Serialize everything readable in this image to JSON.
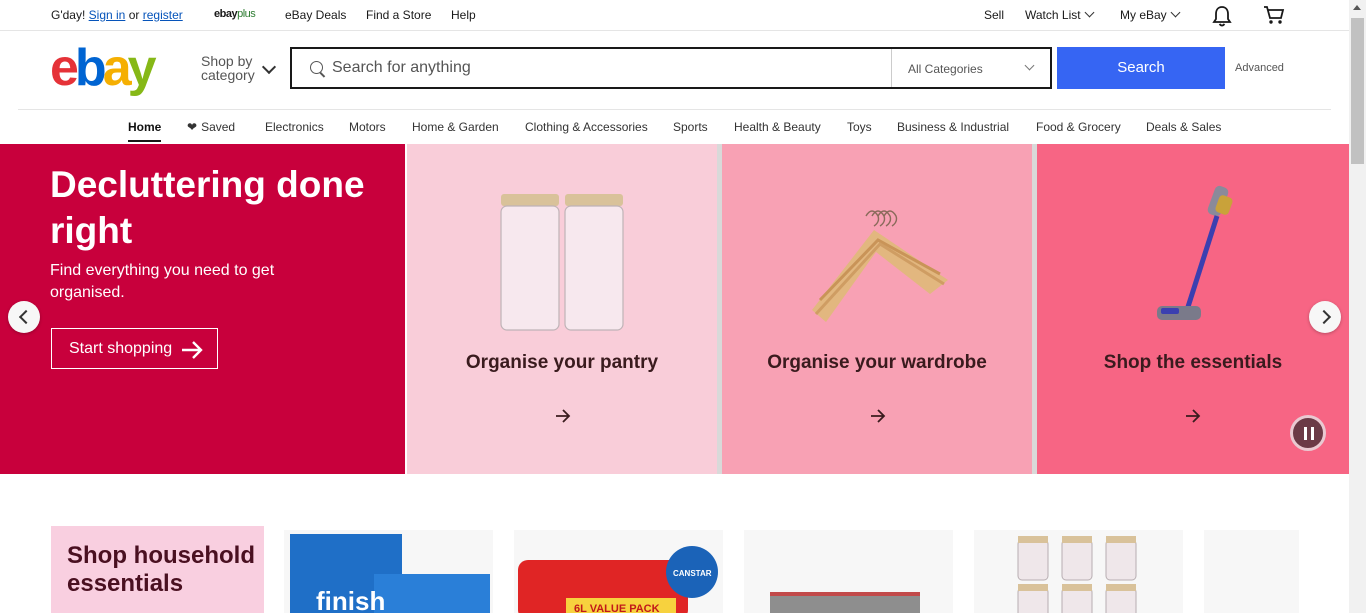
{
  "topbar": {
    "greeting": "G'day!",
    "sign_in": "Sign in",
    "or": "or",
    "register": "register",
    "ebay_plus_brand": "ebay",
    "ebay_plus_suffix": "plus",
    "ebay_deals": "eBay Deals",
    "find_store": "Find a Store",
    "help": "Help",
    "sell": "Sell",
    "watch_list": "Watch List",
    "my_ebay": "My eBay"
  },
  "header": {
    "logo": {
      "e": "e",
      "b": "b",
      "a": "a",
      "y": "y"
    },
    "shop_by_line1": "Shop by",
    "shop_by_line2": "category",
    "search_placeholder": "Search for anything",
    "category_select": "All Categories",
    "search_button": "Search",
    "advanced": "Advanced"
  },
  "nav": {
    "items": [
      "Home",
      "Saved",
      "Electronics",
      "Motors",
      "Home & Garden",
      "Clothing & Accessories",
      "Sports",
      "Health & Beauty",
      "Toys",
      "Business & Industrial",
      "Food & Grocery",
      "Deals & Sales"
    ]
  },
  "hero": {
    "title": "Decluttering done right",
    "subtitle": "Find everything you need to get organised.",
    "button": "Start shopping",
    "tiles": [
      {
        "label": "Organise your pantry",
        "bg": "#f9cdd9"
      },
      {
        "label": "Organise your wardrobe",
        "bg": "#f8a1b4"
      },
      {
        "label": "Shop the essentials",
        "bg": "#f76584"
      }
    ],
    "left_bg": "#c8003c"
  },
  "lower": {
    "promo_title": "Shop household essentials",
    "canstar_badge": "CANSTAR",
    "value_pack": "6L VALUE PACK",
    "finish_brand": "finish"
  },
  "colors": {
    "accent": "#3665f3",
    "link": "#0654ba"
  }
}
